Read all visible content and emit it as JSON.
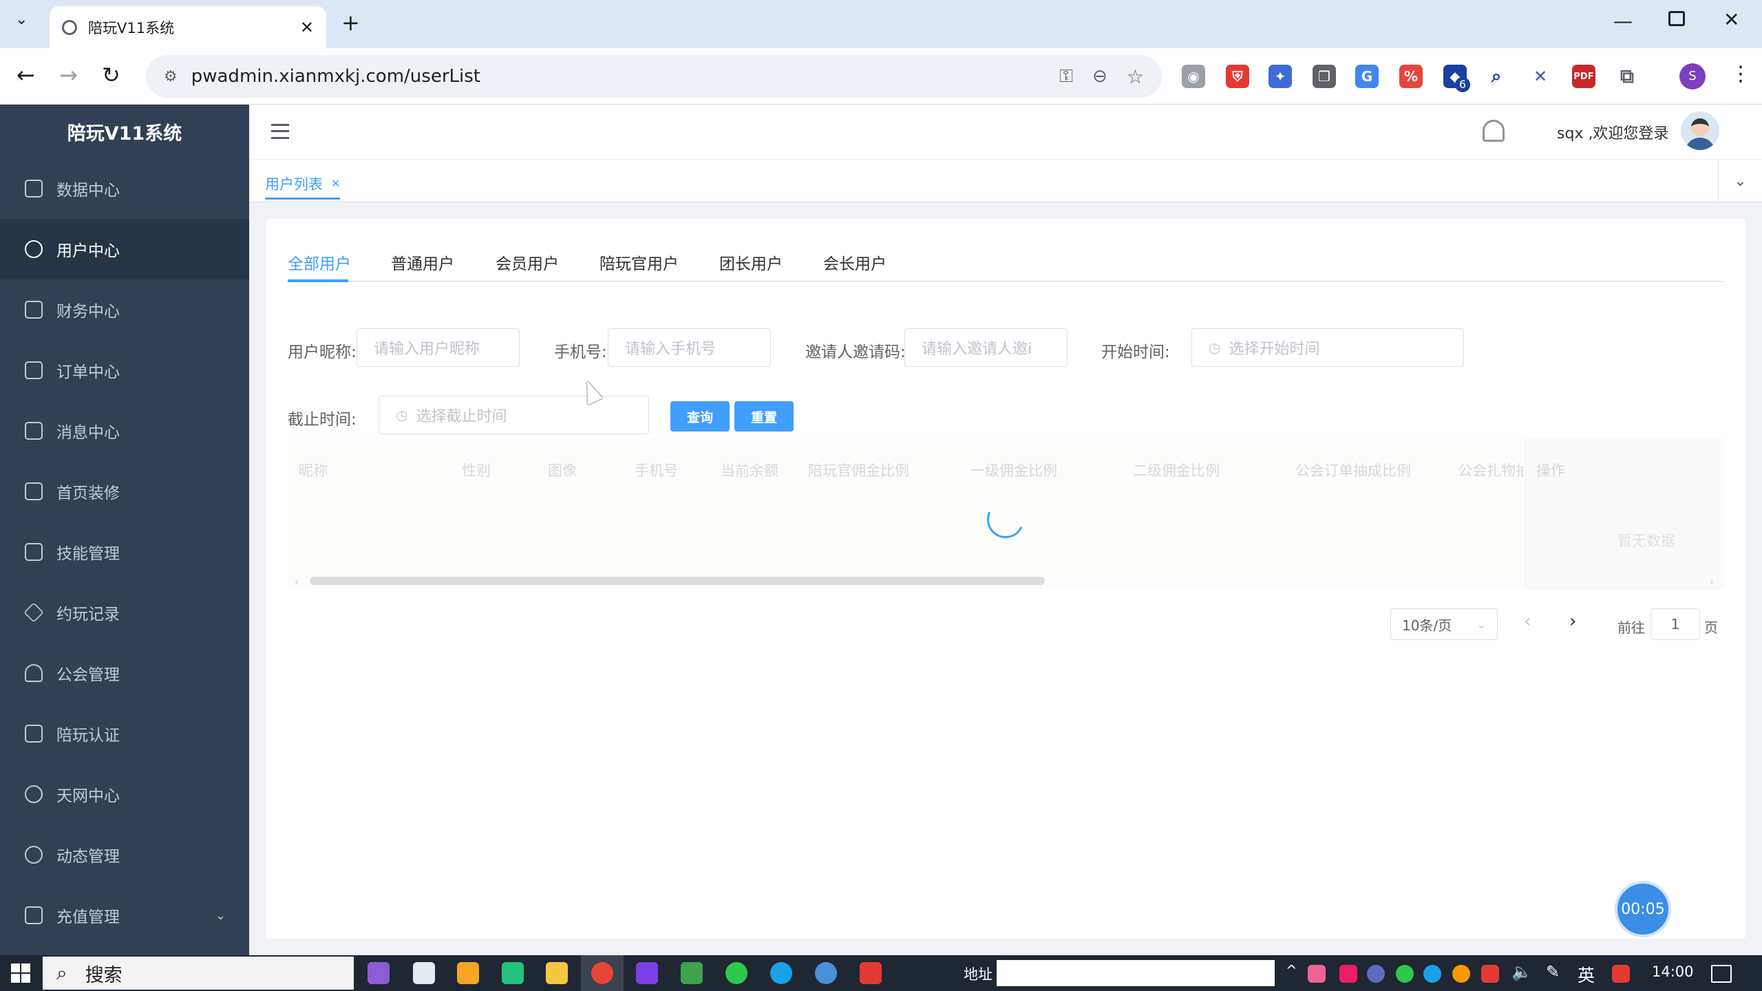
{
  "browser": {
    "tab_title": "陪玩V11系统",
    "tab_close": "✕",
    "new_tab": "+",
    "url": "pwadmin.xianmxkj.com/userList",
    "profile_initial": "S",
    "ext_badge": "6",
    "pdf_label": "PDF"
  },
  "sidebar": {
    "logo": "陪玩V11系统",
    "items": [
      {
        "label": "数据中心"
      },
      {
        "label": "用户中心"
      },
      {
        "label": "财务中心"
      },
      {
        "label": "订单中心"
      },
      {
        "label": "消息中心"
      },
      {
        "label": "首页装修"
      },
      {
        "label": "技能管理"
      },
      {
        "label": "约玩记录"
      },
      {
        "label": "公会管理"
      },
      {
        "label": "陪玩认证"
      },
      {
        "label": "天网中心"
      },
      {
        "label": "动态管理"
      },
      {
        "label": "充值管理"
      }
    ]
  },
  "header": {
    "welcome": "sqx ,欢迎您登录"
  },
  "tags": {
    "active": "用户列表",
    "close": "✕"
  },
  "tabs": [
    "全部用户",
    "普通用户",
    "会员用户",
    "陪玩官用户",
    "团长用户",
    "会长用户"
  ],
  "filters": {
    "nickname_label": "用户昵称:",
    "nickname_placeholder": "请输入用户昵称",
    "phone_label": "手机号:",
    "phone_placeholder": "请输入手机号",
    "invite_label": "邀请人邀请码:",
    "invite_placeholder": "请输入邀请人邀i",
    "start_label": "开始时间:",
    "start_placeholder": "选择开始时间",
    "end_label": "截止时间:",
    "end_placeholder": "选择截止时间",
    "query_btn": "查询",
    "reset_btn": "重置"
  },
  "table": {
    "columns": [
      "昵称",
      "性别",
      "图像",
      "手机号",
      "当前余额",
      "陪玩官佣金比例",
      "一级佣金比例",
      "二级佣金比例",
      "公会订单抽成比例",
      "公会扎物抽",
      "操作"
    ],
    "empty_text": "暂无数据"
  },
  "pagination": {
    "page_size": "10条/页",
    "goto_label": "前往",
    "page_value": "1",
    "page_unit": "页"
  },
  "timer": "00:05",
  "taskbar": {
    "search": "搜索",
    "address_label": "地址",
    "ime": "英",
    "time": "14:00"
  },
  "colors": {
    "sidebar_bg": "#304156",
    "accent": "#409eff"
  }
}
